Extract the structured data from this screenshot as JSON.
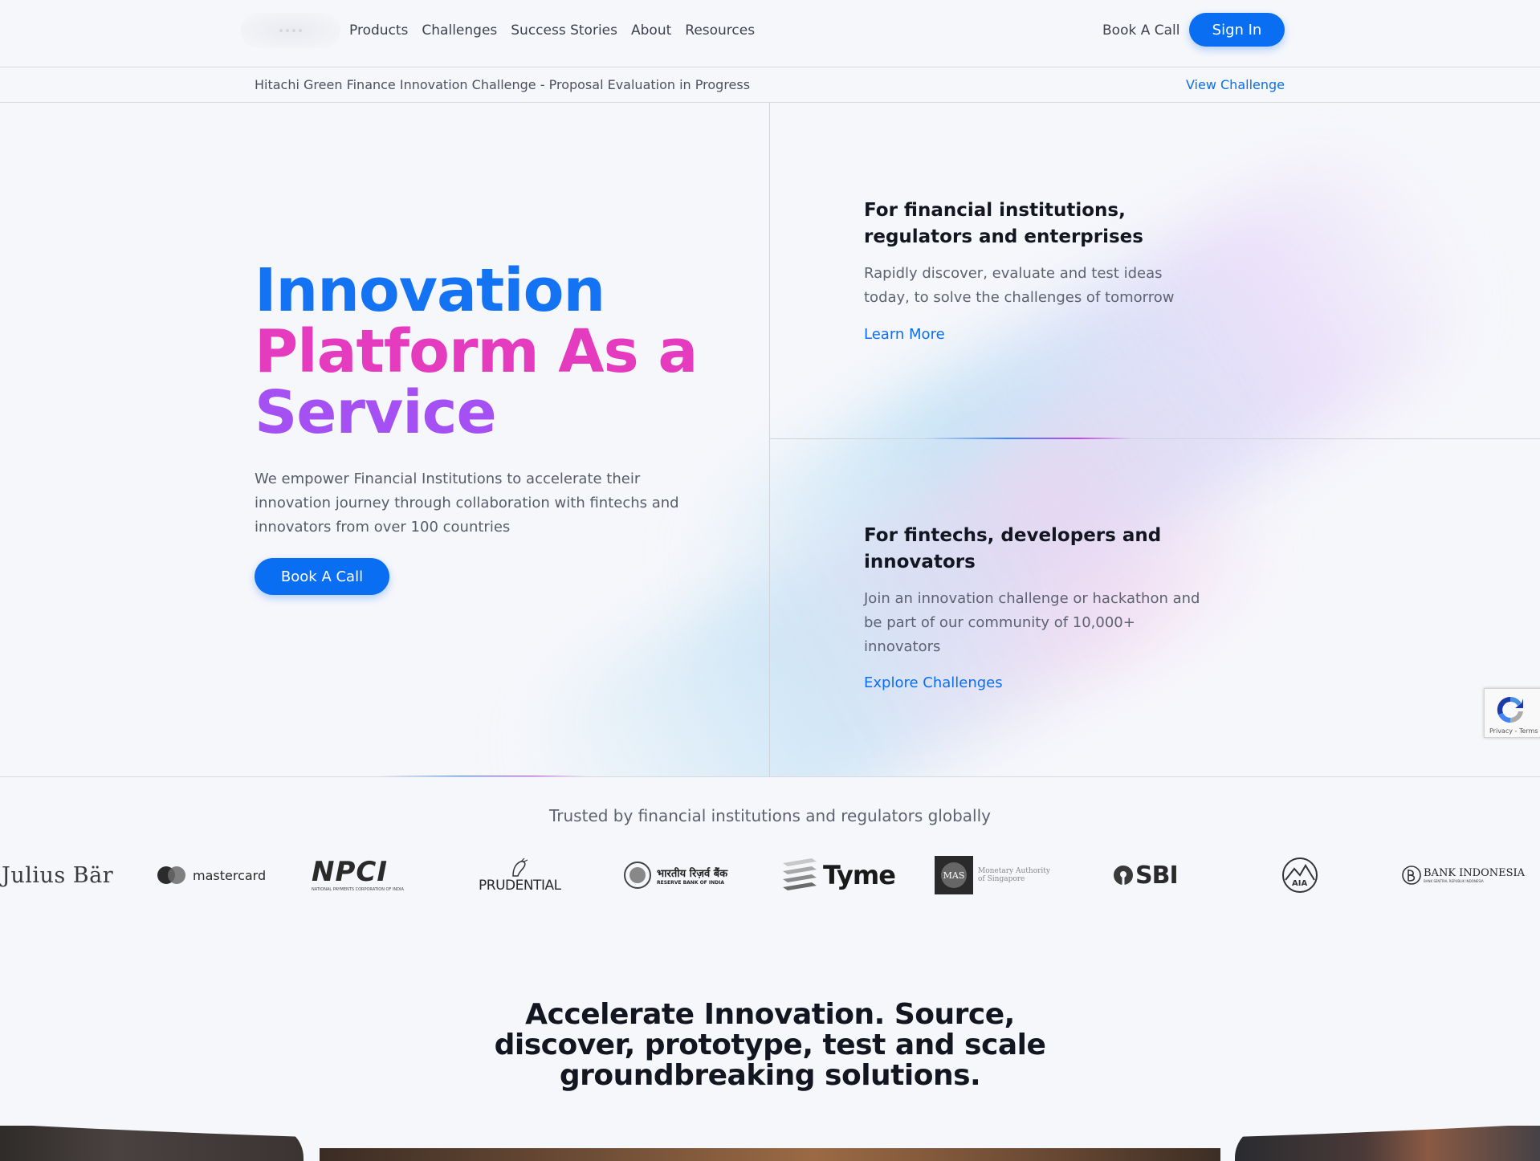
{
  "nav": {
    "links": [
      "Products",
      "Challenges",
      "Success Stories",
      "About",
      "Resources"
    ],
    "book_call": "Book A Call",
    "sign_in": "Sign In"
  },
  "announcement": {
    "text": "Hitachi Green Finance Innovation Challenge - Proposal Evaluation in Progress",
    "link": "View Challenge"
  },
  "hero": {
    "title_line1": "Innovation",
    "title_line2": "Platform As a",
    "title_line3": "Service",
    "description": "We empower Financial Institutions to accelerate their innovation journey through collaboration with fintechs and innovators from over 100 countries",
    "cta": "Book A Call"
  },
  "cards": [
    {
      "title": "For financial institutions, regulators and enterprises",
      "description": "Rapidly discover, evaluate and test ideas today, to solve the challenges of tomorrow",
      "link": "Learn More"
    },
    {
      "title": "For fintechs, developers and innovators",
      "description": "Join an innovation challenge or hackathon and be part of our community of 10,000+ innovators",
      "link": "Explore Challenges"
    }
  ],
  "recaptcha": {
    "text": "Privacy - Terms"
  },
  "trusted": {
    "title": "Trusted by financial institutions and regulators globally",
    "logos": {
      "julius_baer": "Julius Bär",
      "mastercard": "mastercard",
      "npci": "NPCI",
      "npci_sub": "NATIONAL PAYMENTS CORPORATION OF INDIA",
      "prudential": "PRUDENTIAL",
      "rbi_hindi": "भारतीय रिज़र्व बैंक",
      "rbi_english": "RESERVE BANK OF INDIA",
      "tyme": "Tyme",
      "mas_badge": "MAS",
      "mas_name_1": "Monetary Authority",
      "mas_name_2": "of Singapore",
      "sbi": "SBI",
      "aia": "AIA",
      "bi_name": "BANK INDONESIA",
      "bi_sub": "BANK SENTRAL REPUBLIK INDONESIA"
    }
  },
  "tagline": {
    "line1": "Accelerate Innovation. Source,",
    "line2": "discover, prototype, test and scale",
    "line3": "groundbreaking solutions."
  },
  "colors": {
    "primary": "#0a6ef3",
    "title_blue": "#1473f2",
    "title_pink": "#e43bbf",
    "title_purple": "#a450f3",
    "background": "#f6f7fb"
  }
}
